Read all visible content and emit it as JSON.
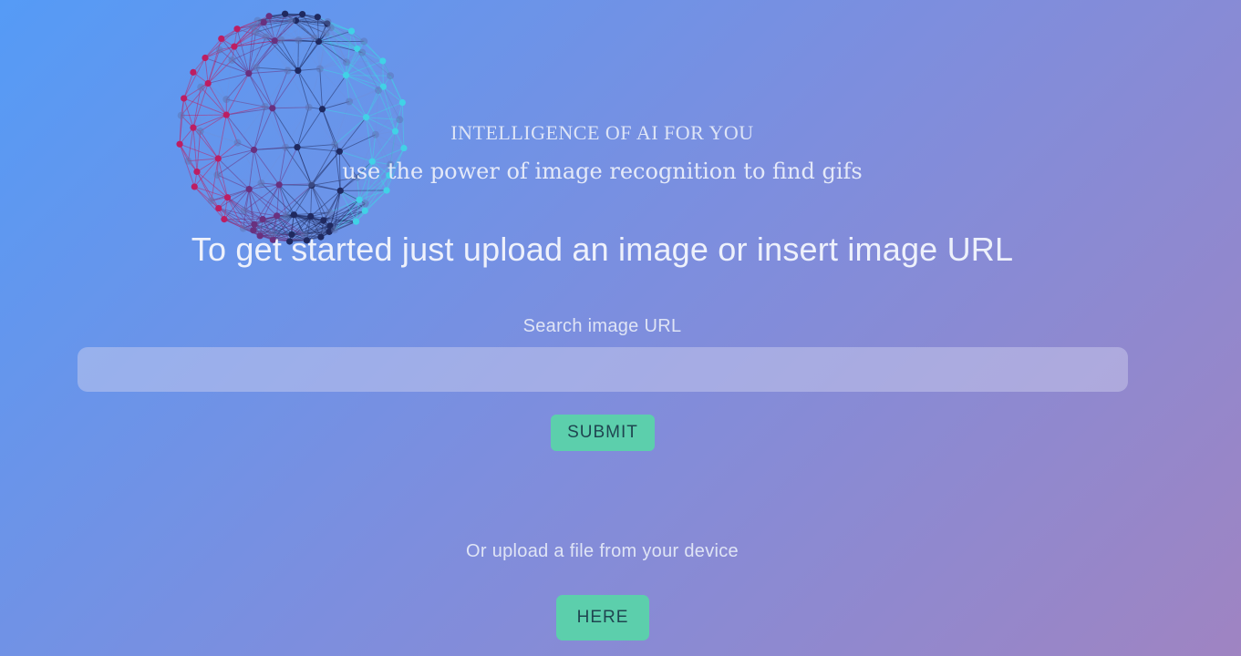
{
  "hero": {
    "eyebrow": "INTELLIGENCE OF AI FOR YOU",
    "tagline": "use the power of image recognition to find gifs",
    "headline": "To get started just upload an image or insert image URL"
  },
  "search": {
    "label": "Search image URL",
    "value": "",
    "submit_label": "SUBMIT"
  },
  "upload": {
    "label": "Or upload a file from your device",
    "button_label": "HERE"
  },
  "colors": {
    "gradient_start": "#559bf6",
    "gradient_mid": "#7d8ede",
    "gradient_end": "#9f84c2",
    "button": "#5ccfac"
  },
  "decoration": {
    "icon": "network-sphere-icon"
  }
}
